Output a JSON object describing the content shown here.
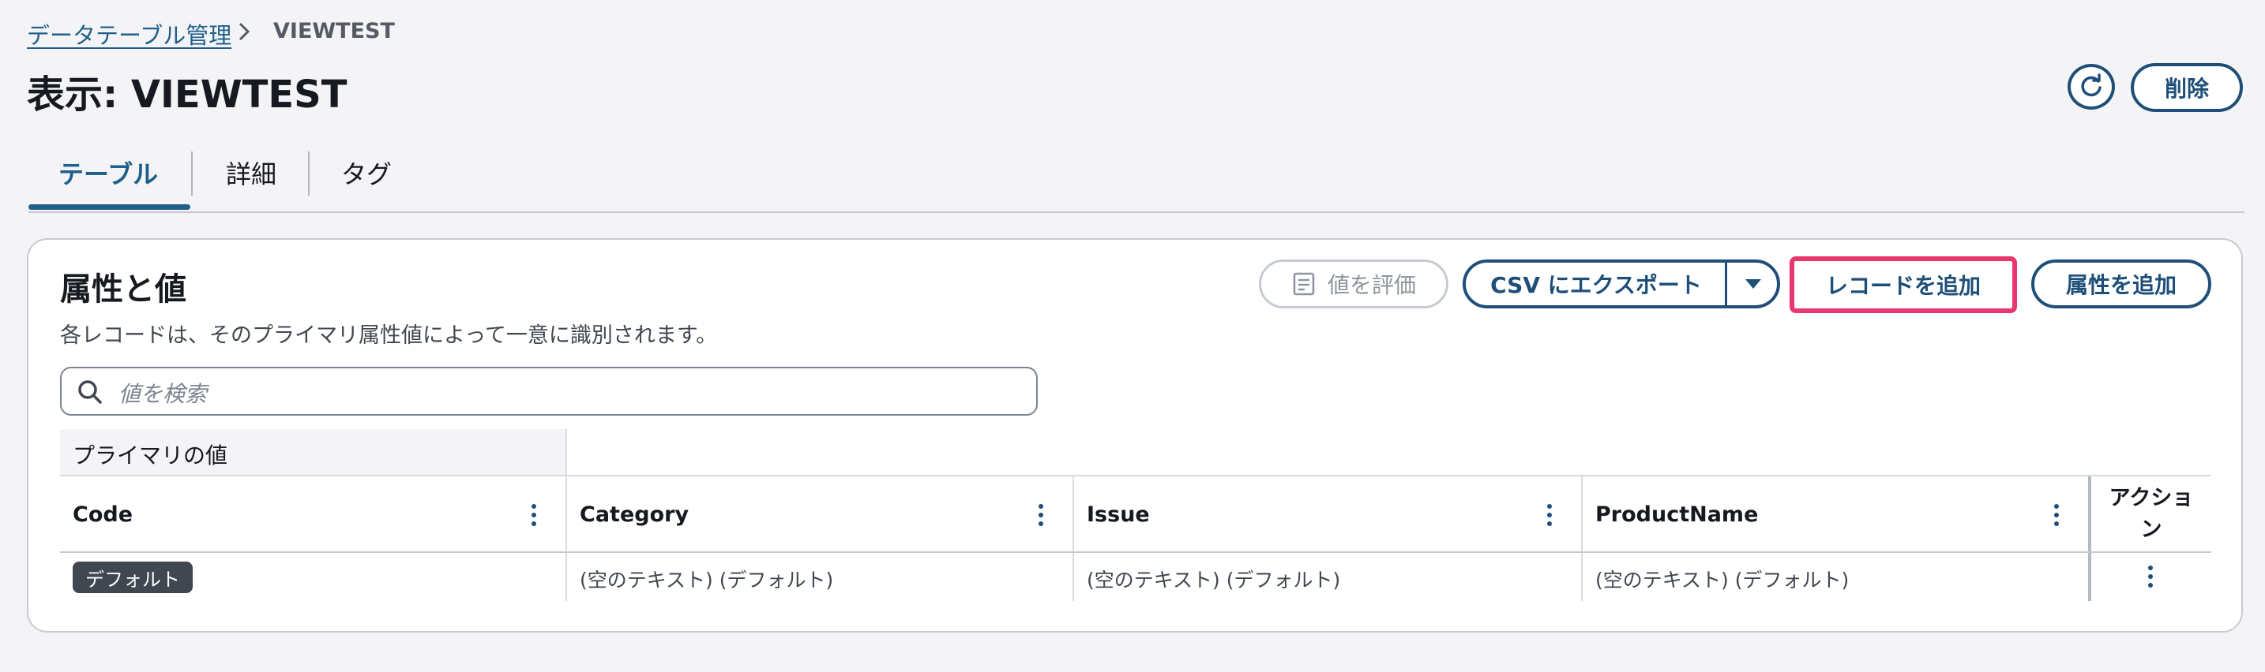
{
  "breadcrumb": {
    "parent": "データテーブル管理",
    "current": "VIEWTEST"
  },
  "header": {
    "title": "表示: VIEWTEST",
    "delete_label": "削除"
  },
  "tabs": [
    {
      "label": "テーブル",
      "active": true
    },
    {
      "label": "詳細",
      "active": false
    },
    {
      "label": "タグ",
      "active": false
    }
  ],
  "card": {
    "title": "属性と値",
    "description": "各レコードは、そのプライマリ属性値によって一意に識別されます。",
    "buttons": {
      "evaluate": "値を評価",
      "export": "CSV にエクスポート",
      "add_record": "レコードを追加",
      "add_attribute": "属性を追加"
    },
    "search_placeholder": "値を検索"
  },
  "table": {
    "group_header": "プライマリの値",
    "columns": [
      "Code",
      "Category",
      "Issue",
      "ProductName"
    ],
    "actions_header": "アクション",
    "rows": [
      {
        "code_badge": "デフォルト",
        "category": "(空のテキスト) (デフォルト)",
        "issue": "(空のテキスト) (デフォルト)",
        "product_name": "(空のテキスト) (デフォルト)"
      }
    ]
  },
  "colors": {
    "primary": "#1f4f78",
    "highlight": "#e8366f",
    "badge_bg": "#414750"
  }
}
